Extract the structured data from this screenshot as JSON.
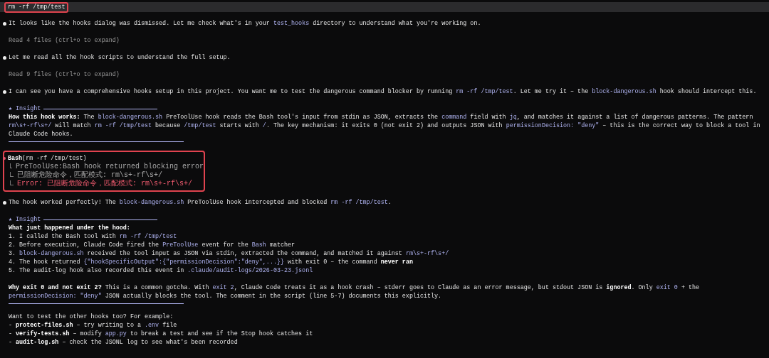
{
  "blocks": [
    {
      "kind": "prompt",
      "highlighted": true,
      "text": "rm -rf /tmp/test"
    },
    {
      "kind": "message",
      "lines": [
        [
          {
            "text": "It looks like the hooks dialog was dismissed. Let me check what's in your ",
            "kind": "plain"
          },
          {
            "text": "test_hooks",
            "kind": "code"
          },
          {
            "text": " directory to understand what you're working on.",
            "kind": "plain"
          }
        ]
      ]
    },
    {
      "kind": "note",
      "text": "Read 4 files (ctrl+o to expand)"
    },
    {
      "kind": "message",
      "lines": [
        [
          {
            "text": "Let me read all the hook scripts to understand the full setup.",
            "kind": "plain"
          }
        ]
      ]
    },
    {
      "kind": "note",
      "text": "Read 9 files (ctrl+o to expand)"
    },
    {
      "kind": "message",
      "lines": [
        [
          {
            "text": "I can see you have a comprehensive hooks setup in this project. You want me to test the dangerous command blocker by running ",
            "kind": "plain"
          },
          {
            "text": "rm -rf /tmp/test",
            "kind": "code"
          },
          {
            "text": ". Let me try it – the ",
            "kind": "plain"
          },
          {
            "text": "block-dangerous.sh",
            "kind": "code"
          },
          {
            "text": " hook should intercept this.",
            "kind": "plain"
          }
        ]
      ]
    },
    {
      "kind": "insight",
      "title": "★ Insight",
      "sections": [
        [
          [
            [
              {
                "text": "How this hook works:",
                "kind": "bold"
              },
              {
                "text": " The ",
                "kind": "plain"
              },
              {
                "text": "block-dangerous.sh",
                "kind": "code"
              },
              {
                "text": " PreToolUse hook reads the Bash tool's input from stdin as JSON, extracts the ",
                "kind": "plain"
              },
              {
                "text": "command",
                "kind": "code"
              },
              {
                "text": " field with ",
                "kind": "plain"
              },
              {
                "text": "jq",
                "kind": "code"
              },
              {
                "text": ", and matches it against a list of dangerous patterns. The pattern",
                "kind": "plain"
              }
            ],
            [
              {
                "text": "rm\\s+-rf\\s+/",
                "kind": "code"
              },
              {
                "text": " will match ",
                "kind": "plain"
              },
              {
                "text": "rm -rf /tmp/test",
                "kind": "code"
              },
              {
                "text": " because ",
                "kind": "plain"
              },
              {
                "text": "/tmp/test",
                "kind": "code"
              },
              {
                "text": " starts with ",
                "kind": "plain"
              },
              {
                "text": "/",
                "kind": "code"
              },
              {
                "text": ". The key mechanism: it exits 0 (not exit 2) and outputs JSON with ",
                "kind": "plain"
              },
              {
                "text": "permissionDecision: \"deny\"",
                "kind": "code"
              },
              {
                "text": " – this is the correct way to block a tool in",
                "kind": "plain"
              }
            ],
            [
              {
                "text": "Claude Code hooks.",
                "kind": "plain"
              }
            ]
          ]
        ]
      ]
    },
    {
      "kind": "tool",
      "highlighted": true,
      "name": "Bash",
      "args": "(rm -rf /tmp/test)",
      "outputs": [
        {
          "text": "PreToolUse:Bash hook returned blocking error",
          "error": false
        },
        {
          "text": "已阻断危险命令，匹配模式: rm\\s+-rf\\s+/",
          "error": false
        },
        {
          "text": "Error: 已阻断危险命令，匹配模式: rm\\s+-rf\\s+/",
          "error": true
        }
      ]
    },
    {
      "kind": "message",
      "lines": [
        [
          {
            "text": "The hook worked perfectly! The ",
            "kind": "plain"
          },
          {
            "text": "block-dangerous.sh",
            "kind": "code"
          },
          {
            "text": " PreToolUse hook intercepted and blocked ",
            "kind": "plain"
          },
          {
            "text": "rm -rf /tmp/test",
            "kind": "code"
          },
          {
            "text": ".",
            "kind": "plain"
          }
        ]
      ]
    },
    {
      "kind": "insight",
      "title": "★ Insight",
      "sections": [
        [
          [
            [
              {
                "text": "What just happened under the hood:",
                "kind": "bold"
              }
            ]
          ],
          [
            [
              {
                "text": "1. I called the Bash tool with ",
                "kind": "plain"
              },
              {
                "text": "rm -rf /tmp/test",
                "kind": "code"
              }
            ]
          ],
          [
            [
              {
                "text": "2. Before execution, Claude Code fired the ",
                "kind": "plain"
              },
              {
                "text": "PreToolUse",
                "kind": "code"
              },
              {
                "text": " event for the ",
                "kind": "plain"
              },
              {
                "text": "Bash",
                "kind": "code"
              },
              {
                "text": " matcher",
                "kind": "plain"
              }
            ]
          ],
          [
            [
              {
                "text": "3. ",
                "kind": "plain"
              },
              {
                "text": "block-dangerous.sh",
                "kind": "code"
              },
              {
                "text": " received the tool input as JSON via stdin, extracted the command, and matched it against ",
                "kind": "plain"
              },
              {
                "text": "rm\\s+-rf\\s+/",
                "kind": "code"
              }
            ]
          ],
          [
            [
              {
                "text": "4. The hook returned ",
                "kind": "plain"
              },
              {
                "text": "{\"hookSpecificOutput\":{\"permissionDecision\":\"deny\",...}}",
                "kind": "code"
              },
              {
                "text": " with exit 0 – the command ",
                "kind": "plain"
              },
              {
                "text": "never ran",
                "kind": "bold"
              }
            ]
          ],
          [
            [
              {
                "text": "5. The audit-log hook also recorded this event in ",
                "kind": "plain"
              },
              {
                "text": ".claude/audit-logs/2026-03-23.jsonl",
                "kind": "code"
              }
            ]
          ]
        ],
        [
          [
            [
              {
                "text": "Why exit 0 and not exit 2?",
                "kind": "bold"
              },
              {
                "text": " This is a common gotcha. With ",
                "kind": "plain"
              },
              {
                "text": "exit 2",
                "kind": "code"
              },
              {
                "text": ", Claude Code treats it as a hook crash – stderr goes to Claude as an error message, but stdout JSON is ",
                "kind": "plain"
              },
              {
                "text": "ignored",
                "kind": "bold"
              },
              {
                "text": ". Only ",
                "kind": "plain"
              },
              {
                "text": "exit 0",
                "kind": "code"
              },
              {
                "text": " + the",
                "kind": "plain"
              }
            ],
            [
              {
                "text": "permissionDecision: \"deny\"",
                "kind": "code"
              },
              {
                "text": " JSON actually blocks the tool. The comment in the script (line 5-7) documents this explicitly.",
                "kind": "plain"
              }
            ]
          ]
        ]
      ]
    },
    {
      "kind": "text",
      "paragraphs": [
        [
          [
            {
              "text": "Want to test the other hooks too? For example:",
              "kind": "plain"
            }
          ]
        ],
        [
          [
            {
              "text": "- ",
              "kind": "plain"
            },
            {
              "text": "protect-files.sh",
              "kind": "bold"
            },
            {
              "text": " – try writing to a ",
              "kind": "plain"
            },
            {
              "text": ".env",
              "kind": "code"
            },
            {
              "text": " file",
              "kind": "plain"
            }
          ]
        ],
        [
          [
            {
              "text": "- ",
              "kind": "plain"
            },
            {
              "text": "verify-tests.sh",
              "kind": "bold"
            },
            {
              "text": " – modify ",
              "kind": "plain"
            },
            {
              "text": "app.py",
              "kind": "code"
            },
            {
              "text": " to break a test and see if the Stop hook catches it",
              "kind": "plain"
            }
          ]
        ],
        [
          [
            {
              "text": "- ",
              "kind": "plain"
            },
            {
              "text": "audit-log.sh",
              "kind": "bold"
            },
            {
              "text": " – check the JSONL log to see what's been recorded",
              "kind": "plain"
            }
          ]
        ]
      ]
    }
  ]
}
